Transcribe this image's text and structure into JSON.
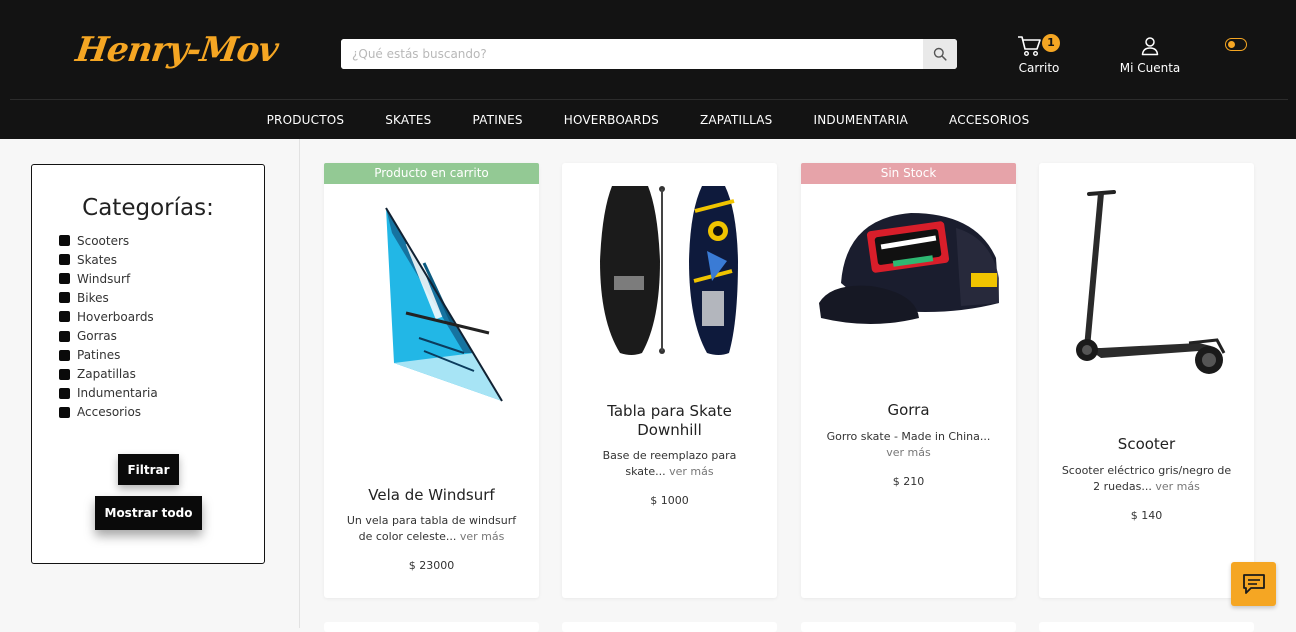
{
  "header": {
    "logo_text": "Henry-Mov",
    "search_placeholder": "¿Qué estás buscando?",
    "cart_label": "Carrito",
    "cart_count": "1",
    "account_label": "Mi Cuenta",
    "accent_color": "#f5a623"
  },
  "nav": {
    "items": [
      "PRODUCTOS",
      "SKATES",
      "PATINES",
      "HOVERBOARDS",
      "ZAPATILLAS",
      "INDUMENTARIA",
      "ACCESORIOS"
    ]
  },
  "sidebar": {
    "title": "Categorías:",
    "categories": [
      "Scooters",
      "Skates",
      "Windsurf",
      "Bikes",
      "Hoverboards",
      "Gorras",
      "Patines",
      "Zapatillas",
      "Indumentaria",
      "Accesorios"
    ],
    "filter_button": "Filtrar",
    "show_all_button": "Mostrar todo"
  },
  "products": [
    {
      "badge": "Producto en carrito",
      "badge_color": "#93c994",
      "title": "Vela de Windsurf",
      "description": "Un vela para tabla de windsurf de color celeste...",
      "more": " ver más",
      "price": "$ 23000",
      "image_icon": "windsurf-sail-image"
    },
    {
      "badge": "",
      "title": "Tabla para Skate Downhill",
      "description": "Base de reemplazo para skate...",
      "more": " ver más",
      "price": "$ 1000",
      "image_icon": "skateboard-deck-image"
    },
    {
      "badge": "Sin Stock",
      "badge_color": "#e6a3a9",
      "title": "Gorra",
      "description": "Gorro skate - Made in China...",
      "more": " ver más",
      "price": "$ 210",
      "image_icon": "cap-image"
    },
    {
      "badge": "",
      "title": "Scooter",
      "description": "Scooter eléctrico gris/negro de 2 ruedas...",
      "more": " ver más",
      "price": "$ 140",
      "image_icon": "scooter-image"
    }
  ],
  "chat": {
    "icon": "chat-icon"
  }
}
